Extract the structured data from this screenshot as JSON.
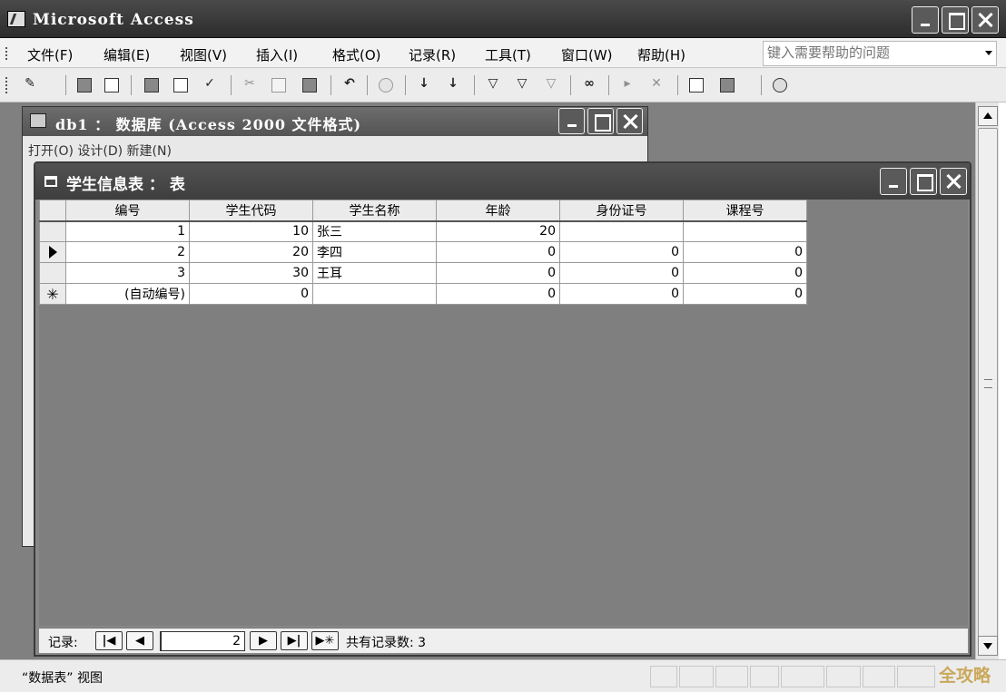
{
  "app": {
    "title": "Microsoft Access"
  },
  "menu": {
    "items": [
      "文件(F)",
      "编辑(E)",
      "视图(V)",
      "插入(I)",
      "格式(O)",
      "记录(R)",
      "工具(T)",
      "窗口(W)",
      "帮助(H)"
    ],
    "help_placeholder": "键入需要帮助的问题"
  },
  "toolbar": {
    "buttons": [
      "design-view-icon",
      "save-icon",
      "search-file-icon",
      "print-icon",
      "print-preview-icon",
      "spelling-icon",
      "cut-icon",
      "copy-icon",
      "paste-icon",
      "undo-icon",
      "hyperlink-icon",
      "sort-ascending-icon",
      "sort-descending-icon",
      "filter-by-selection-icon",
      "filter-by-form-icon",
      "apply-filter-icon",
      "find-icon",
      "new-record-icon",
      "delete-record-icon",
      "database-window-icon",
      "new-object-icon",
      "help-icon"
    ]
  },
  "db_window": {
    "title": "db1 ： 数据库 (Access 2000 文件格式)",
    "toolbar_text": "打开(O)  设计(D)  新建(N)"
  },
  "table_window": {
    "title": "学生信息表 ： 表",
    "columns": [
      "编号",
      "学生代码",
      "学生名称",
      "年龄",
      "身份证号",
      "课程号"
    ],
    "rows": [
      {
        "id": "1",
        "code": "10",
        "name": "张三",
        "age": "20",
        "idcard": "",
        "course": ""
      },
      {
        "id": "2",
        "code": "20",
        "name": "李四",
        "age": "0",
        "idcard": "0",
        "course": "0"
      },
      {
        "id": "3",
        "code": "30",
        "name": "王耳",
        "age": "0",
        "idcard": "0",
        "course": "0"
      }
    ],
    "new_row": {
      "id": "(自动编号)",
      "code": "0",
      "name": "",
      "age": "0",
      "idcard": "0",
      "course": "0"
    },
    "current_row_index": 1
  },
  "navigation": {
    "label": "记录:",
    "current": "2",
    "total_text": "共有记录数: 3"
  },
  "status": {
    "text": "“数据表” 视图"
  },
  "watermark": {
    "text": "全攻略"
  },
  "colors": {
    "title_bar": "#3a3a3a",
    "mdi_background": "#808080",
    "grid_header": "#ebebeb"
  }
}
